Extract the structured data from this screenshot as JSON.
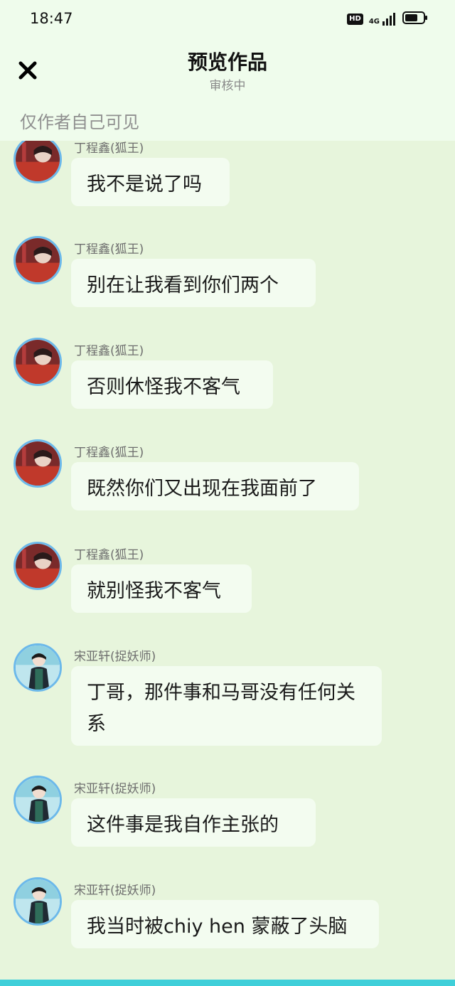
{
  "status": {
    "time": "18:47",
    "hd": "HD",
    "network": "4G",
    "battery_level": 0.7
  },
  "header": {
    "title": "预览作品",
    "subtitle": "审核中",
    "visibility_note": "仅作者自己可见"
  },
  "messages": [
    {
      "name": "丁程鑫(狐王)",
      "text": "我不是说了吗",
      "avatar": "red"
    },
    {
      "name": "丁程鑫(狐王)",
      "text": "别在让我看到你们两个",
      "avatar": "red"
    },
    {
      "name": "丁程鑫(狐王)",
      "text": "否则休怪我不客气",
      "avatar": "red"
    },
    {
      "name": "丁程鑫(狐王)",
      "text": "既然你们又出现在我面前了",
      "avatar": "red"
    },
    {
      "name": "丁程鑫(狐王)",
      "text": "就别怪我不客气",
      "avatar": "red"
    },
    {
      "name": "宋亚轩(捉妖师)",
      "text": "丁哥，那件事和马哥没有任何关系",
      "avatar": "teal"
    },
    {
      "name": "宋亚轩(捉妖师)",
      "text": "这件事是我自作主张的",
      "avatar": "teal"
    },
    {
      "name": "宋亚轩(捉妖师)",
      "text": "我当时被chiy hen 蒙蔽了头脑",
      "avatar": "teal"
    }
  ],
  "colors": {
    "background": "#e7f5dc",
    "header_bg": "#effcec",
    "bubble_bg": "#f3fcf0",
    "avatar_ring": "#6cb9ea"
  }
}
